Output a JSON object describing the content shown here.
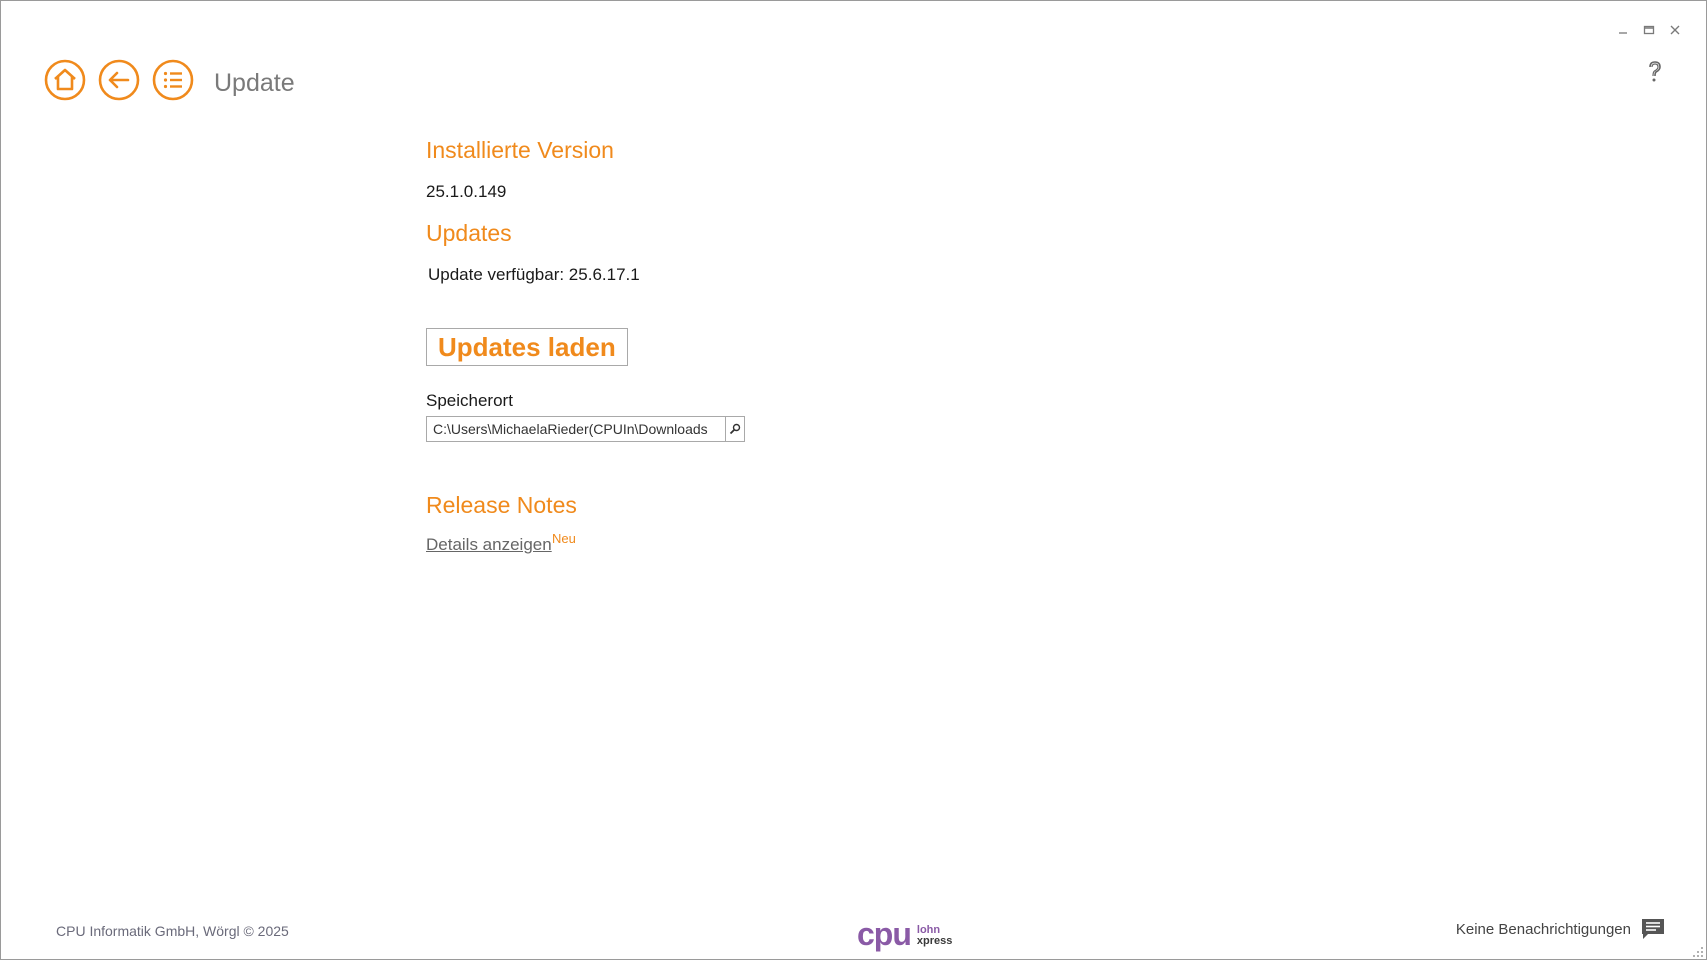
{
  "window": {
    "controls": {
      "minimize": "minimize-icon",
      "maximize": "maximize-icon",
      "close": "close-icon"
    },
    "help_icon": "help-icon"
  },
  "header": {
    "title": "Update",
    "nav": [
      "home-icon",
      "back-icon",
      "menu-list-icon"
    ]
  },
  "installed": {
    "heading": "Installierte Version",
    "version": "25.1.0.149"
  },
  "updates": {
    "heading": "Updates",
    "status": "Update verfügbar: 25.6.17.1",
    "button_label": "Updates laden"
  },
  "storage": {
    "label": "Speicherort",
    "path": "C:\\Users\\MichaelaRieder(CPUIn\\Downloads",
    "search_icon": "search-icon"
  },
  "release_notes": {
    "heading": "Release Notes",
    "link": "Details anzeigen",
    "badge": "Neu"
  },
  "footer": {
    "copyright": "CPU Informatik GmbH, Wörgl  ©  2025",
    "logo_main": "cpu",
    "logo_line1": "lohn",
    "logo_line2": "xpress",
    "notifications": "Keine Benachrichtigungen"
  },
  "colors": {
    "accent": "#f08a1c",
    "logo_purple": "#8a5aa6"
  }
}
